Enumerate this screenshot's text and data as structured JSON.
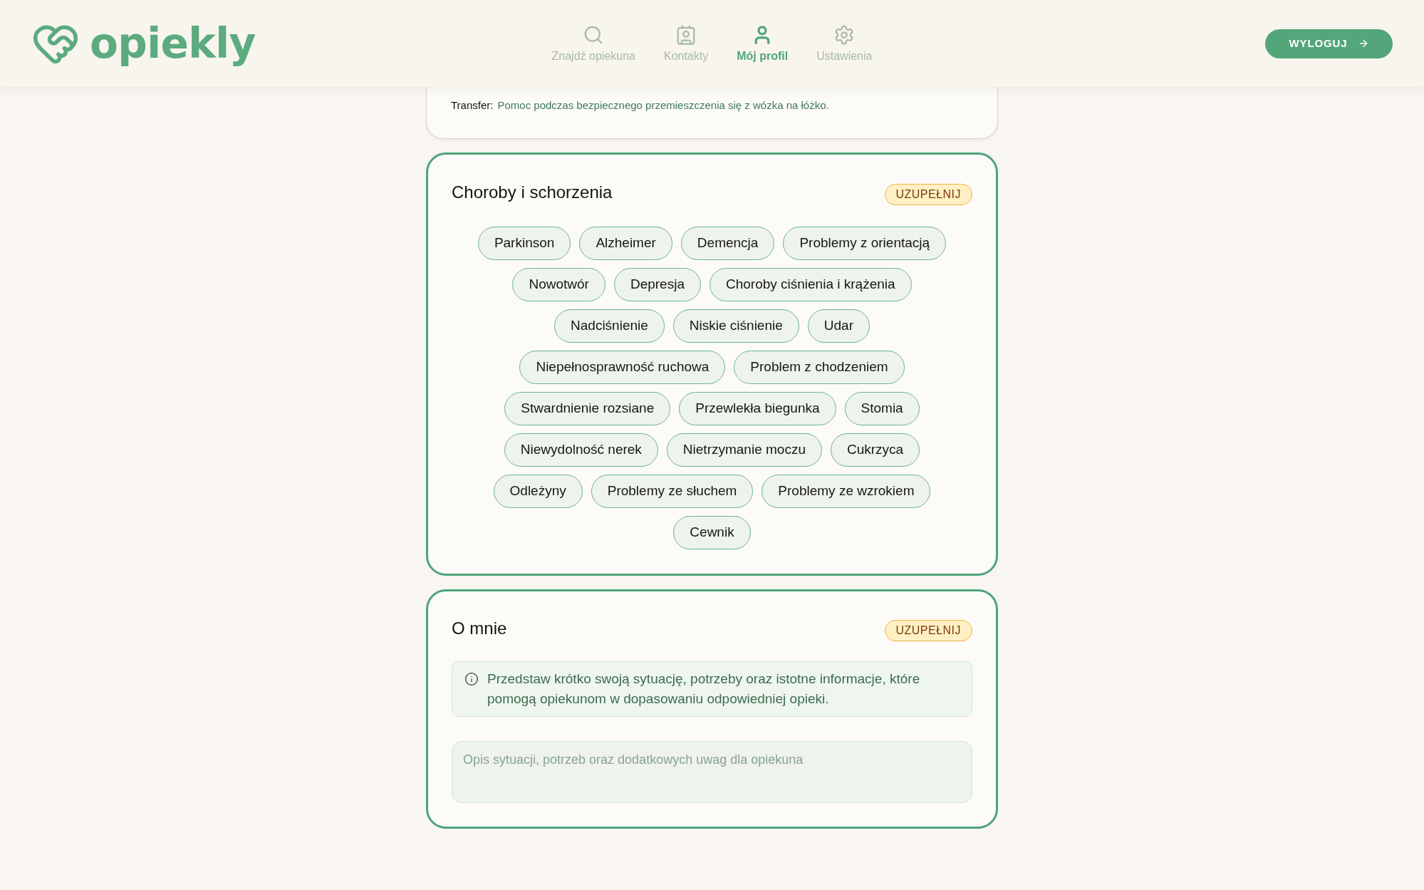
{
  "header": {
    "logo": {
      "text": "opiekly"
    },
    "nav": [
      {
        "label": "Znajdź opiekuna",
        "selected": false
      },
      {
        "label": "Kontakty",
        "selected": false
      },
      {
        "label": "Mój profil",
        "selected": true
      },
      {
        "label": "Ustawienia",
        "selected": false
      }
    ],
    "logout_button": {
      "label": "WYLOGUJ"
    }
  },
  "sections": [
    {
      "kind": "details",
      "rows": [
        {
          "label": "Transfer:",
          "value": "Pomoc podczas bezpiecznego przemieszczenia się z wózka na łóżko."
        }
      ]
    },
    {
      "kind": "tags",
      "title": "Choroby i schorzenia",
      "badge": "UZUPEŁNIJ",
      "tags": [
        "Parkinson",
        "Alzheimer",
        "Demencja",
        "Problemy z orientacją",
        "Nowotwór",
        "Depresja",
        "Choroby ciśnienia i krążenia",
        "Nadciśnienie",
        "Niskie ciśnienie",
        "Udar",
        "Niepełnosprawność ruchowa",
        "Problem z chodzeniem",
        "Stwardnienie rozsiane",
        "Przewlekła biegunka",
        "Stomia",
        "Niewydolność nerek",
        "Nietrzymanie moczu",
        "Cukrzyca",
        "Odleżyny",
        "Problemy ze słuchem",
        "Problemy ze wzrokiem",
        "Cewnik"
      ]
    },
    {
      "kind": "text",
      "title": "O mnie",
      "badge": "UZUPEŁNIJ",
      "info": "Przedstaw krótko swoją sytuację, potrzeby oraz istotne informacje, które pomogą opiekunom w dopasowaniu odpowiedniej opieki.",
      "textarea": {
        "placeholder": "Opis sytuacji, potrzeb oraz dodatkowych uwag dla opiekuna"
      }
    }
  ]
}
